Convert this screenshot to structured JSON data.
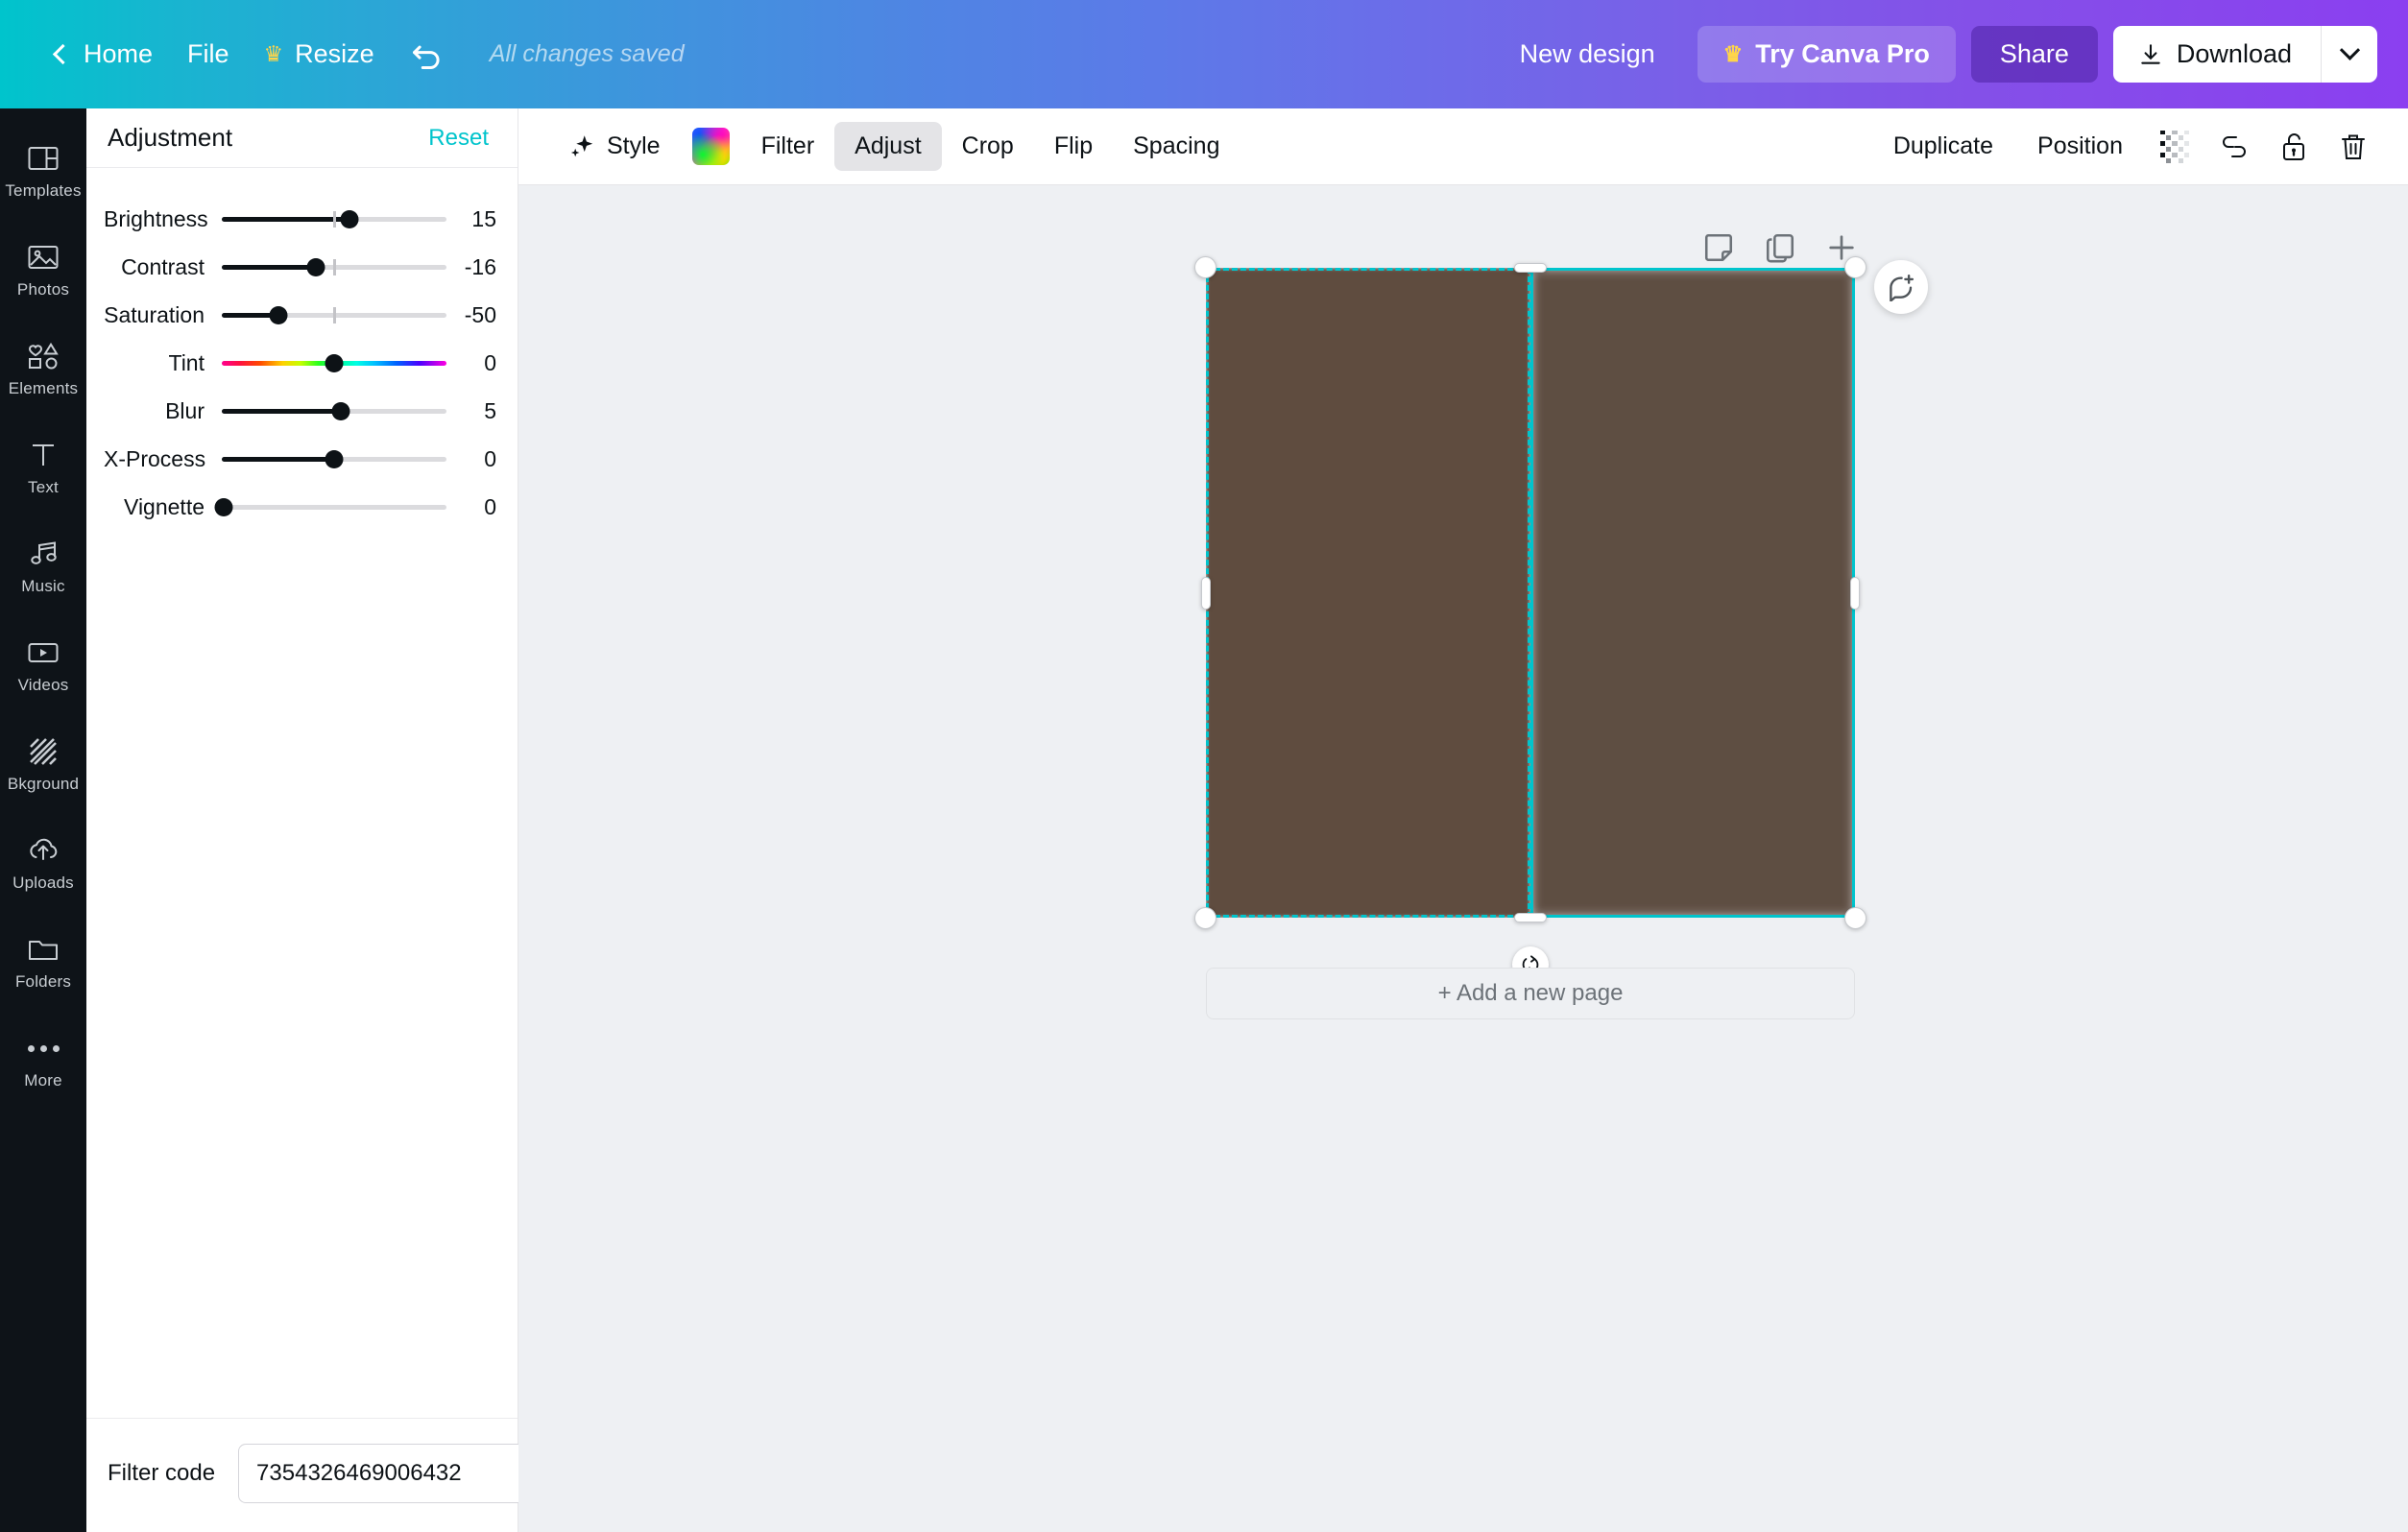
{
  "header": {
    "home_label": "Home",
    "file_label": "File",
    "resize_label": "Resize",
    "undo_icon": "undo-arrow-icon",
    "saved_status": "All changes saved",
    "new_design_label": "New design",
    "pro_label": "Try Canva Pro",
    "pro_icon": "crown-icon",
    "share_label": "Share",
    "download_label": "Download",
    "download_icon": "download-arrow-icon",
    "download_caret_icon": "chevron-down-icon",
    "gradient_start": "#00c4cc",
    "gradient_end": "#8b3ff0"
  },
  "rail": {
    "items": [
      {
        "label": "Templates",
        "icon": "templates-icon"
      },
      {
        "label": "Photos",
        "icon": "photos-icon"
      },
      {
        "label": "Elements",
        "icon": "elements-icon"
      },
      {
        "label": "Text",
        "icon": "text-icon"
      },
      {
        "label": "Music",
        "icon": "music-icon"
      },
      {
        "label": "Videos",
        "icon": "videos-icon"
      },
      {
        "label": "Bkground",
        "icon": "background-icon"
      },
      {
        "label": "Uploads",
        "icon": "uploads-icon"
      },
      {
        "label": "Folders",
        "icon": "folders-icon"
      },
      {
        "label": "More",
        "icon": "more-dots-icon"
      }
    ]
  },
  "panel": {
    "title": "Adjustment",
    "reset_label": "Reset",
    "reset_color": "#00c4cc",
    "sliders": [
      {
        "label": "Brightness",
        "value": "15",
        "pct": 57,
        "tick": true,
        "type": "plain"
      },
      {
        "label": "Contrast",
        "value": "-16",
        "pct": 42,
        "tick": true,
        "type": "plain"
      },
      {
        "label": "Saturation",
        "value": "-50",
        "pct": 25,
        "tick": true,
        "type": "plain"
      },
      {
        "label": "Tint",
        "value": "0",
        "pct": 50,
        "tick": false,
        "type": "tint"
      },
      {
        "label": "Blur",
        "value": "5",
        "pct": 53,
        "tick": false,
        "type": "plain"
      },
      {
        "label": "X-Process",
        "value": "0",
        "pct": 50,
        "tick": false,
        "type": "plain"
      },
      {
        "label": "Vignette",
        "value": "0",
        "pct": 0,
        "tick": false,
        "type": "plain"
      }
    ],
    "filter_code_label": "Filter code",
    "filter_code_value": "7354326469006432"
  },
  "toolbar": {
    "style_label": "Style",
    "style_icon": "sparkle-icon",
    "color_swatch_icon": "rainbow-color-swatch",
    "filter_label": "Filter",
    "adjust_label": "Adjust",
    "crop_label": "Crop",
    "flip_label": "Flip",
    "spacing_label": "Spacing",
    "duplicate_label": "Duplicate",
    "position_label": "Position",
    "transparency_icon": "transparency-checker-icon",
    "link_icon": "link-icon",
    "lock_icon": "unlocked-padlock-icon",
    "delete_icon": "trash-icon",
    "active_tab": "Adjust"
  },
  "canvas": {
    "page_tools": [
      {
        "icon": "notes-icon"
      },
      {
        "icon": "duplicate-page-icon"
      },
      {
        "icon": "add-page-icon"
      }
    ],
    "comment_icon": "add-comment-icon",
    "rotate_icon": "rotate-handle-icon",
    "selection_color": "#00c4cc",
    "add_page_label": "+ Add a new page",
    "image_alt": "roasted-coffee-beans"
  }
}
